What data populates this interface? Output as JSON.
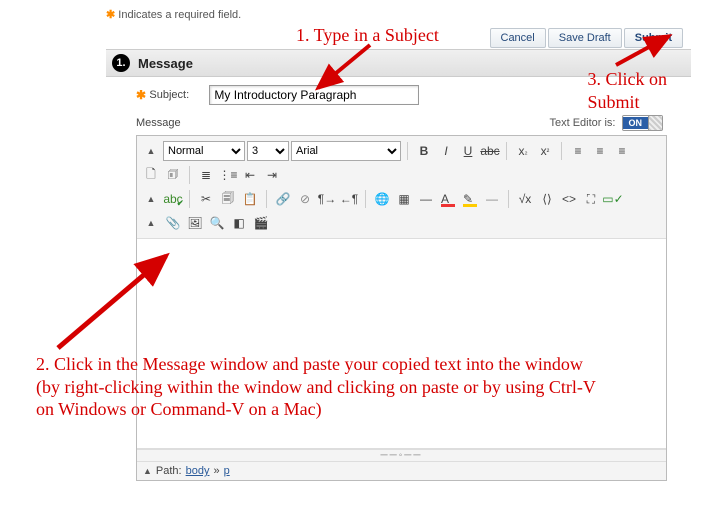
{
  "required_note": "Indicates a required field.",
  "actions": {
    "cancel": "Cancel",
    "save_draft": "Save Draft",
    "submit": "Submit"
  },
  "section": {
    "number": "1.",
    "title": "Message"
  },
  "subject": {
    "label": "Subject:",
    "value": "My Introductory Paragraph"
  },
  "message_label": "Message",
  "text_editor": {
    "label": "Text Editor is:",
    "state": "ON"
  },
  "toolbar": {
    "format": "Normal",
    "size": "3",
    "font": "Arial",
    "spellcheck": "abc"
  },
  "path": {
    "label": "Path:",
    "segments": [
      "body",
      "p"
    ]
  },
  "annotations": {
    "a1": "1. Type in a Subject",
    "a2": "2. Click in the Message window and paste your copied text into the window (by right-clicking within the window and clicking on paste or by using Ctrl-V on Windows or Command-V on a Mac)",
    "a3_line1": "3. Click on",
    "a3_line2": "Submit"
  }
}
